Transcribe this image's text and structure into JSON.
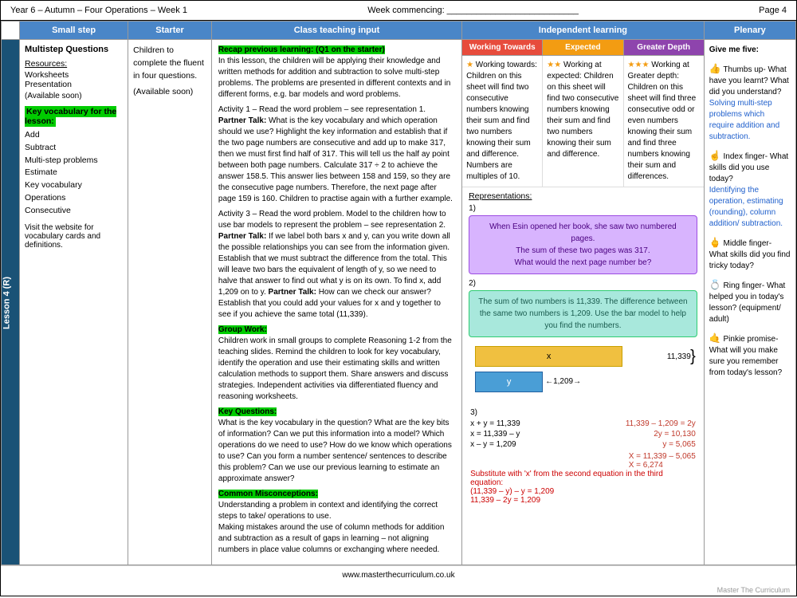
{
  "header": {
    "title": "Year 6 – Autumn – Four Operations – Week 1",
    "week": "Week commencing: ___________________________",
    "page": "Page 4"
  },
  "columns": {
    "small_step": "Small step",
    "starter": "Starter",
    "class_teaching": "Class teaching input",
    "independent": "Independent learning",
    "plenary": "Plenary"
  },
  "lesson_label": "Lesson 4 (R)",
  "small_step": {
    "title": "Multistep Questions",
    "resources_label": "Resources:",
    "resources": [
      "Worksheets",
      "Presentation"
    ],
    "available": "(Available soon)",
    "key_vocab_label": "Key vocabulary for the lesson:",
    "vocab_list": [
      "Add",
      "Subtract",
      "Multi-step problems",
      "Estimate",
      "Key vocabulary",
      "Operations",
      "Consecutive"
    ],
    "website_note": "Visit the website for vocabulary cards and definitions."
  },
  "starter": {
    "text": "Children to complete the fluent in four questions.",
    "available": "(Available soon)"
  },
  "class_teaching": {
    "recap_label": "Recap previous learning: (Q1 on the starter)",
    "recap_body": "In this lesson, the children will be applying their knowledge and written methods for addition and subtraction to solve multi-step problems. The problems are presented in different contexts and in different forms, e.g. bar models and word problems.",
    "activity1": "Activity 1 – Read the word problem – see representation 1.",
    "partner_talk1": "Partner Talk:",
    "partner_talk1_text": " What is the key vocabulary and which operation should we use? Highlight the key information and establish that if the two page numbers are consecutive and add up to make 317, then we must first find half of 317. This will tell us the half ay point between both page numbers. Calculate 317 ÷ 2 to achieve the answer 158.5. This answer lies between 158 and 159, so they are the consecutive page numbers. Therefore, the next page after page 159 is 160. Children to practise again with a further example.",
    "activity3": "Activity 3 – Read the word problem. Model to the children how to use bar models to represent the problem – see representation 2.",
    "partner_talk2": "Partner Talk:",
    "partner_talk2_text": " If we label both bars x and y, can you write down all the possible relationships you can see from the information given. Establish that we must subtract the difference from the total. This will leave two bars the equivalent of length of y, so we need to halve that answer to find out what y is on its own. To find x, add 1,209 on to y.",
    "partner_talk3": "Partner Talk:",
    "partner_talk3_text": " How can we check our answer? Establish that you could add your values for x and y together to see if you achieve the same total (11,339).",
    "group_work_label": "Group Work:",
    "group_work_text": "Children work in small groups to complete Reasoning 1-2 from the teaching slides. Remind the children to look for key vocabulary, identify the operation and use their estimating skills and written calculation methods to support them. Share answers and discuss strategies. Independent activities via differentiated fluency and reasoning worksheets.",
    "key_q_label": "Key Questions:",
    "key_q_text": "What is the key vocabulary in the question? What are the key bits of information? Can we put this information into a model? Which operations do we need to use? How do we know which operations to use? Can you form a number sentence/ sentences to describe this problem? Can we use our previous learning to estimate an approximate answer?",
    "misconceptions_label": "Common Misconceptions:",
    "misconceptions_text": "Understanding a problem in context and identifying the correct steps to take/ operations to use.\nMaking mistakes around the use of column methods for addition and subtraction as a result of gaps in learning – not aligning numbers in place value columns or exchanging where needed."
  },
  "independent": {
    "sub_headers": [
      {
        "label": "Working Towards",
        "color": "#e74c3c"
      },
      {
        "label": "Expected",
        "color": "#f39c12"
      },
      {
        "label": "Greater Depth",
        "color": "#8e44ad"
      }
    ],
    "working_towards": {
      "stars": 1,
      "text": "Working towards: Children on this sheet will find two consecutive numbers knowing their sum and find two numbers knowing their sum and difference. Numbers are multiples of 10."
    },
    "expected": {
      "stars": 2,
      "text": "Working at expected: Children on this sheet will find two consecutive numbers knowing their sum and find two numbers knowing their sum and difference."
    },
    "greater_depth": {
      "stars": 3,
      "text": "Working at Greater depth: Children on this sheet will find three consecutive odd or even numbers knowing their sum and find three numbers knowing their sum and differences."
    },
    "representations_label": "Representations:",
    "rep1_label": "1)",
    "rep1_text": "When Esin opened her book, she saw two numbered pages.\nThe sum of these two pages was 317.\nWhat would the next page number be?",
    "rep2_label": "2)",
    "rep2_text": "The sum of two numbers is 11,339. The difference between the same two numbers is 1,209. Use the bar model to help you find the numbers.",
    "bar_x_label": "x",
    "bar_y_label": "y",
    "bar_11339": "11,339",
    "bar_1209": "←1,209→",
    "rep3_label": "3)",
    "equations": {
      "left": [
        "x + y = 11,339",
        "x = 11,339 – y",
        "x – y = 1,209"
      ],
      "right": [
        "11,339 – 1,209 = 2y",
        "2y = 10,130",
        "y = 5,065"
      ],
      "right2_label": "X = 11,339 – 5,065",
      "right2_val": "X = 6,274"
    },
    "substitute_text": "Substitute with 'x' from the second equation in the third equation:",
    "substitute_steps": [
      "(11,339 – y) – y = 1,209",
      "11,339 – 2y = 1,209"
    ]
  },
  "plenary": {
    "title": "Give me five:",
    "thumb_label": "👍 Thumbs up-",
    "thumb_text": "What have you learnt? What did you understand?",
    "thumb_blue": "Solving multi-step problems which require addition and subtraction.",
    "index_label": "☝ Index finger-",
    "index_text": "What skills did you use today?",
    "index_blue": "Identifying the operation, estimating (rounding), column addition/ subtraction.",
    "middle_label": "🖕 Middle finger-",
    "middle_text": "What skills did you find tricky today?",
    "ring_label": "💍 Ring finger-",
    "ring_text": "What helped you in today's lesson? (equipment/ adult)",
    "pinkie_label": "🤙 Pinkie promise-",
    "pinkie_text": "What will you make sure you remember from today's lesson?"
  },
  "footer": {
    "website": "www.masterthecurriculum.co.uk",
    "logo": "Master The Curriculum"
  }
}
